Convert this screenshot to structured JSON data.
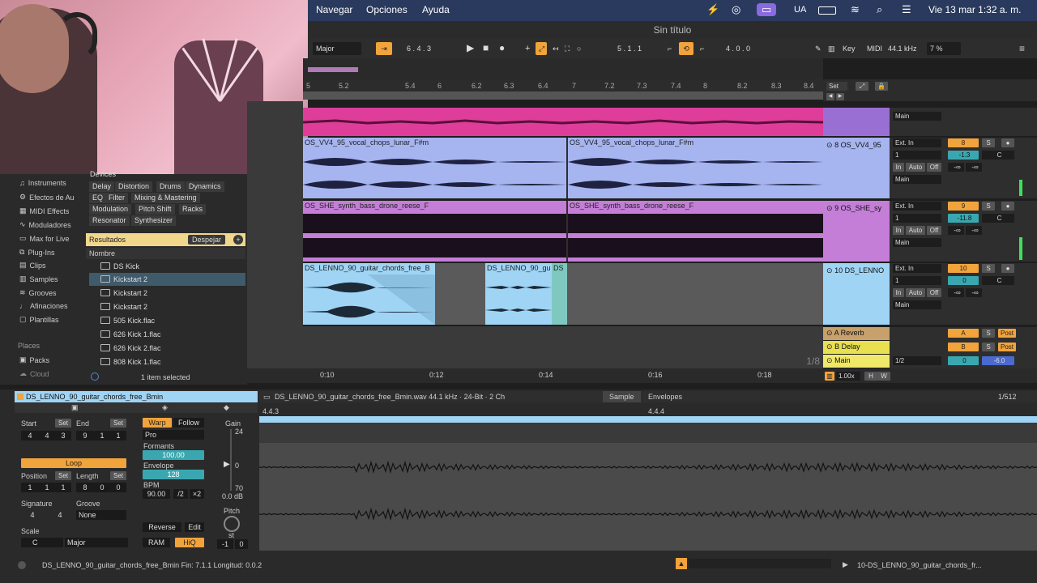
{
  "menubar": {
    "items": [
      "Navegar",
      "Opciones",
      "Ayuda"
    ],
    "input_lang": "UA",
    "datetime": "Vie 13 mar  1:32 a. m."
  },
  "window_title": "Sin título",
  "transport": {
    "scale": "Major",
    "position": "6 .  4 .  3",
    "loop_start": "5 .  1 .  1",
    "loop_length": "4 .  0 .  0",
    "key_label": "Key",
    "midi_label": "MIDI",
    "sample_rate": "44.1 kHz",
    "cpu": "7 %"
  },
  "ruler": {
    "ticks": [
      "5",
      "5.2",
      "5.4",
      "6",
      "6.2",
      "6.3",
      "6.4",
      "7",
      "7.2",
      "7.3",
      "7.4",
      "8",
      "8.2",
      "8.3",
      "8.4"
    ],
    "set_label": "Set"
  },
  "time_ruler": [
    "0:10",
    "0:12",
    "0:14",
    "0:16",
    "0:18"
  ],
  "zoom_fraction": "1/8",
  "tracks": [
    {
      "header": "8 OS_VV4_95",
      "clips": [
        "OS_VV4_95_vocal_chops_lunar_F#m",
        "OS_VV4_95_vocal_chops_lunar_F#m"
      ],
      "input": "Ext. In",
      "channel": "1",
      "output": "Main",
      "number": "8",
      "volume": "-1.3",
      "pan": "C",
      "send_a": "-∞",
      "send_b": "-∞"
    },
    {
      "header": "9 OS_SHE_sy",
      "clips": [
        "OS_SHE_synth_bass_drone_reese_F",
        "OS_SHE_synth_bass_drone_reese_F"
      ],
      "input": "Ext. In",
      "channel": "1",
      "output": "Main",
      "number": "9",
      "volume": "-11.8",
      "pan": "C",
      "send_a": "-∞",
      "send_b": "-∞"
    },
    {
      "header": "10 DS_LENNO",
      "clips": [
        "DS_LENNO_90_guitar_chords_free_B",
        "DS_LENNO_90_gu",
        "DS"
      ],
      "input": "Ext. In",
      "channel": "1",
      "output": "Main",
      "number": "10",
      "volume": "0",
      "pan": "C",
      "send_a": "-∞",
      "send_b": "-∞"
    }
  ],
  "top_track_output": "Main",
  "returns": [
    {
      "name": "A Reverb",
      "letter": "A",
      "post": "Post"
    },
    {
      "name": "B Delay",
      "letter": "B",
      "post": "Post"
    },
    {
      "name": "Main",
      "meter": "1/2",
      "volume": "0",
      "db": "-6.0"
    }
  ],
  "monitor_labels": {
    "in": "In",
    "auto": "Auto",
    "off": "Off",
    "s": "S"
  },
  "tempo_scale": "1.00x",
  "browser": {
    "sidebar": [
      "Instruments",
      "Efectos de Au",
      "MIDI Effects",
      "Moduladores",
      "Max for Live",
      "Plug-Ins",
      "Clips",
      "Samples",
      "Grooves",
      "Afinaciones",
      "Plantillas"
    ],
    "places_label": "Places",
    "places": [
      "Packs",
      "Cloud"
    ],
    "devices_label": "Devices",
    "device_tags": [
      "Delay",
      "Distortion",
      "Drums",
      "Dynamics",
      "EQ",
      "Filter",
      "Mixing & Mastering",
      "Modulation",
      "Pitch Shift",
      "Racks",
      "Resonator",
      "Synthesizer"
    ],
    "results_label": "Resultados",
    "clear_label": "Despejar",
    "name_header": "Nombre",
    "files": [
      "DS Kick",
      "Kickstart 2",
      "Kickstart 2",
      "Kickstart 2",
      "505 Kick.flac",
      "626 Kick 1.flac",
      "626 Kick 2.flac",
      "808 Kick 1.flac"
    ],
    "selected_index": 1,
    "status": "1 item selected"
  },
  "clip_view": {
    "clip_name": "DS_LENNO_90_guitar_chords_free_Bmin",
    "file_info": "DS_LENNO_90_guitar_chords_free_Bmin.wav  44.1 kHz · 24-Bit · 2 Ch",
    "tabs": [
      "Sample",
      "Envelopes"
    ],
    "page": "1/512",
    "ruler": [
      "4.4.3",
      "4.4.4"
    ],
    "start_label": "Start",
    "end_label": "End",
    "set_label": "Set",
    "start": [
      "4",
      "4",
      "3"
    ],
    "end": [
      "9",
      "1",
      "1"
    ],
    "loop_label": "Loop",
    "position_label": "Position",
    "length_label": "Length",
    "position": [
      "1",
      "1",
      "1"
    ],
    "length": [
      "8",
      "0",
      "0"
    ],
    "signature_label": "Signature",
    "groove_label": "Groove",
    "signature": [
      "4",
      "4"
    ],
    "groove": "None",
    "scale_label": "Scale",
    "scale_root": "C",
    "scale_mode": "Major",
    "warp_label": "Warp",
    "follow_label": "Follow",
    "warp_mode": "Pro",
    "formants_label": "Formants",
    "formants": "100.00",
    "envelope_label": "Envelope",
    "envelope": "128",
    "bpm_label": "BPM",
    "bpm": "90.00",
    "half": "/2",
    "double": "×2",
    "reverse_label": "Reverse",
    "edit_label": "Edit",
    "ram_label": "RAM",
    "hiq_label": "HiQ",
    "gain_label": "Gain",
    "gain_max": "24",
    "gain_mid": "0",
    "gain_min": "70",
    "gain_db": "0.0 dB",
    "pitch_label": "Pitch",
    "pitch_unit": "st",
    "pitch_value": "-1",
    "pitch_cents": "0"
  },
  "status_bar": {
    "info": "DS_LENNO_90_guitar_chords_free_Bmin  Fin: 7.1.1  Longitud: 0.0.2",
    "right": "10-DS_LENNO_90_guitar_chords_fr..."
  },
  "colors": {
    "accent": "#f1a33c",
    "pink": "#e040a0",
    "blue_clip": "#a8b8f0",
    "purple_clip": "#c77fd8",
    "light_blue": "#9fd4f5",
    "menubar": "#2a3a5e"
  }
}
